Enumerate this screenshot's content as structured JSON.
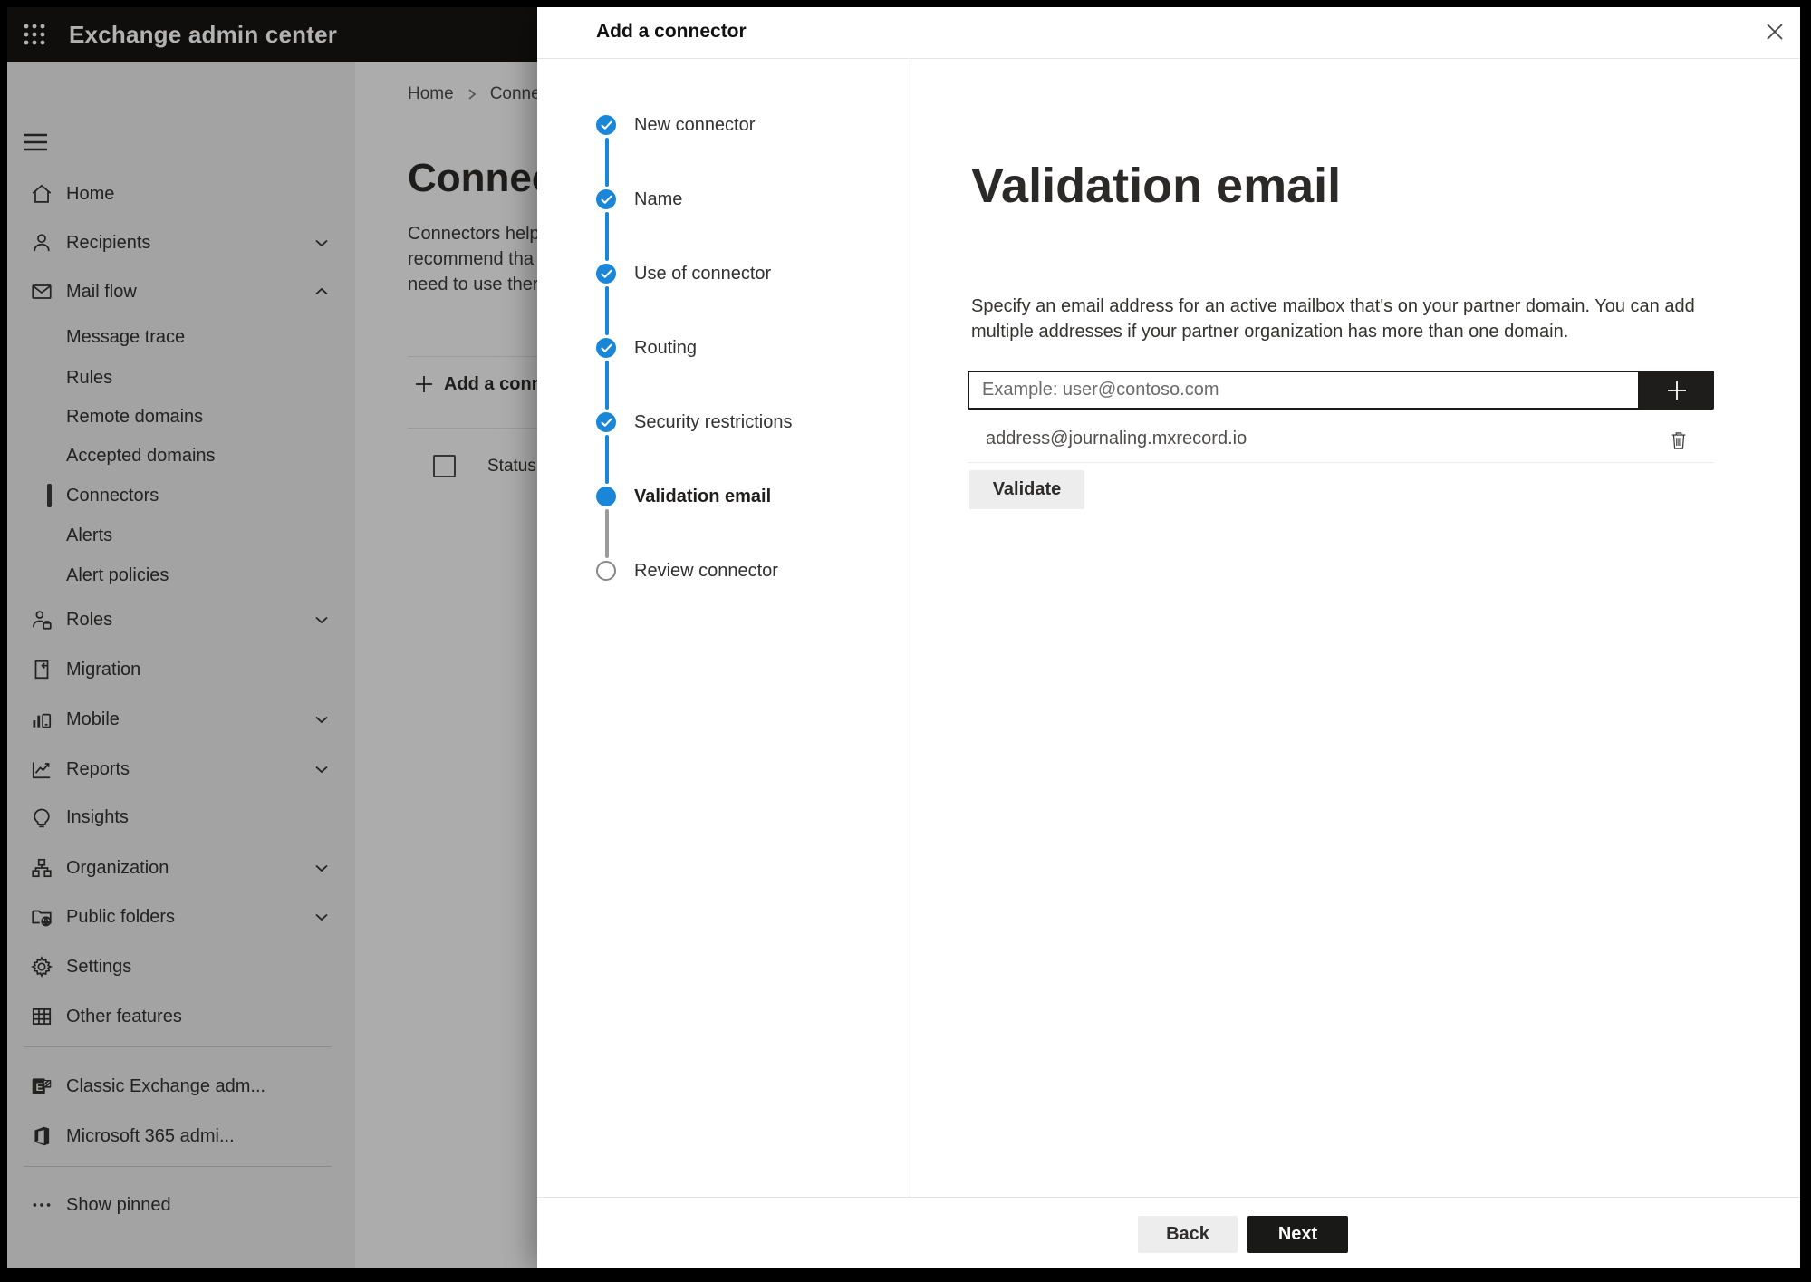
{
  "header": {
    "title": "Exchange admin center"
  },
  "sidebar": {
    "items": [
      {
        "label": "Home"
      },
      {
        "label": "Recipients"
      },
      {
        "label": "Mail flow"
      },
      {
        "label": "Message trace"
      },
      {
        "label": "Rules"
      },
      {
        "label": "Remote domains"
      },
      {
        "label": "Accepted domains"
      },
      {
        "label": "Connectors",
        "selected": true
      },
      {
        "label": "Alerts"
      },
      {
        "label": "Alert policies"
      },
      {
        "label": "Roles"
      },
      {
        "label": "Migration"
      },
      {
        "label": "Mobile"
      },
      {
        "label": "Reports"
      },
      {
        "label": "Insights"
      },
      {
        "label": "Organization"
      },
      {
        "label": "Public folders"
      },
      {
        "label": "Settings"
      },
      {
        "label": "Other features"
      },
      {
        "label": "Classic Exchange adm..."
      },
      {
        "label": "Microsoft 365 admi..."
      },
      {
        "label": "Show pinned"
      }
    ]
  },
  "page": {
    "breadcrumb": {
      "home": "Home",
      "current": "Conne"
    },
    "title": "Connec",
    "description_lines": [
      "Connectors help",
      "recommend tha",
      "need to use ther"
    ],
    "add_button_label": "Add a conn",
    "column_status": "Status"
  },
  "modal": {
    "title": "Add a connector",
    "steps": [
      {
        "label": "New connector",
        "state": "completed"
      },
      {
        "label": "Name",
        "state": "completed"
      },
      {
        "label": "Use of connector",
        "state": "completed"
      },
      {
        "label": "Routing",
        "state": "completed"
      },
      {
        "label": "Security restrictions",
        "state": "completed"
      },
      {
        "label": "Validation email",
        "state": "current"
      },
      {
        "label": "Review connector",
        "state": "upcoming"
      }
    ],
    "panel": {
      "heading": "Validation email",
      "description": "Specify an email address for an active mailbox that's on your partner domain. You can add multiple addresses if your partner organization has more than one domain.",
      "email_placeholder": "Example: user@contoso.com",
      "addresses": [
        {
          "email": "address@journaling.mxrecord.io"
        }
      ],
      "validate_label": "Validate"
    },
    "footer": {
      "back_label": "Back",
      "next_label": "Next"
    },
    "colors": {
      "accent": "#1a86d8",
      "dark_button": "#1e1d1c",
      "header_bg": "#161514"
    }
  }
}
